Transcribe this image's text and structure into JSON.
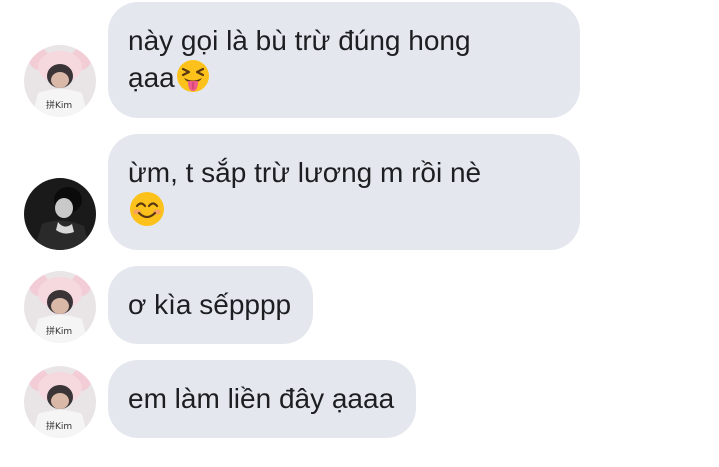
{
  "conversation": {
    "messages": [
      {
        "sender": "pink-hat-user",
        "lines": [
          "này gọi là bù trừ đúng hong",
          "ạaa"
        ],
        "emoji": "squinting-tongue-face-emoji"
      },
      {
        "sender": "dark-photo-user",
        "lines": [
          "ừm, t sắp trừ lương m rồi nè",
          ""
        ],
        "emoji": "smiling-blush-face-emoji"
      },
      {
        "sender": "pink-hat-user",
        "lines": [
          "ơ kìa sếpppp"
        ]
      },
      {
        "sender": "pink-hat-user",
        "lines": [
          "em làm liền đây ạaaa"
        ]
      }
    ]
  },
  "colors": {
    "bubble": "#e4e8ee",
    "text": "#1c1e21",
    "background": "#ffffff"
  }
}
